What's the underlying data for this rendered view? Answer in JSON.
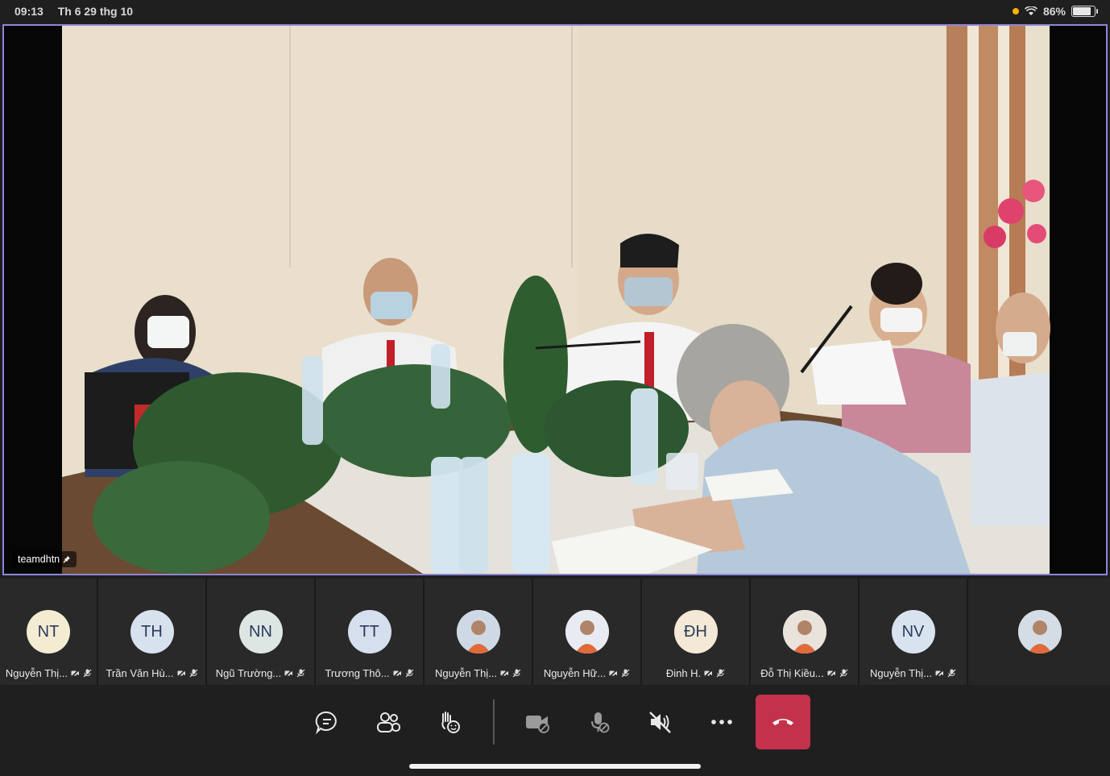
{
  "status_bar": {
    "time": "09:13",
    "date": "Th 6 29 thg 10",
    "battery": "86%",
    "battery_level": 0.86,
    "icons": [
      "orange-dot-icon",
      "wifi-icon",
      "battery-icon"
    ]
  },
  "main_video": {
    "pinned_user": "teamdhtn",
    "pin_icon": "pin-icon"
  },
  "participants": [
    {
      "initials": "NT",
      "name": "Nguyễn Thị...",
      "avatar_color": "#f4ecd2",
      "photo": false
    },
    {
      "initials": "TH",
      "name": "Trần Văn Hù...",
      "avatar_color": "#d7e2ee",
      "photo": false
    },
    {
      "initials": "NN",
      "name": "Ngũ Trường...",
      "avatar_color": "#dde6e3",
      "photo": false
    },
    {
      "initials": "TT",
      "name": "Trương Thô...",
      "avatar_color": "#d5dfee",
      "photo": false
    },
    {
      "initials": "",
      "name": "Nguyễn Thị...",
      "avatar_color": "#cfd9e6",
      "photo": true
    },
    {
      "initials": "",
      "name": "Nguyễn Hữ...",
      "avatar_color": "#e8ecf2",
      "photo": true
    },
    {
      "initials": "ĐH",
      "name": "Đinh H.",
      "avatar_color": "#f4e8d6",
      "photo": false
    },
    {
      "initials": "",
      "name": "Đỗ Thị Kiều...",
      "avatar_color": "#eae3dc",
      "photo": true
    },
    {
      "initials": "NV",
      "name": "Nguyễn Thị...",
      "avatar_color": "#d9e3ef",
      "photo": false
    },
    {
      "initials": "",
      "name": "",
      "avatar_color": "#d4dde6",
      "photo": true
    }
  ],
  "controls": {
    "buttons": [
      "chat-icon",
      "participants-icon",
      "raise-hand-icon",
      "camera-off-icon",
      "mic-off-icon",
      "speaker-off-icon",
      "more-icon",
      "hang-up-icon"
    ],
    "hangup_color": "#c4314b"
  }
}
